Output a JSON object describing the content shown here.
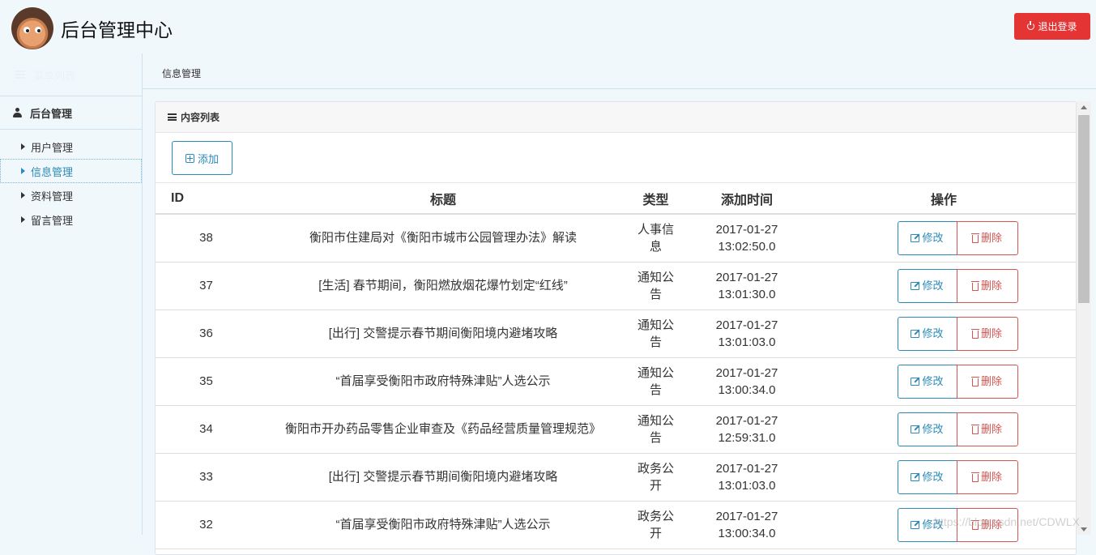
{
  "header": {
    "title": "后台管理中心",
    "logout_label": "退出登录",
    "logout_color": "#e53434"
  },
  "sidebar": {
    "menu_list_label": "菜单列表",
    "group_label": "后台管理",
    "items": [
      {
        "label": "用户管理",
        "active": false
      },
      {
        "label": "信息管理",
        "active": true
      },
      {
        "label": "资料管理",
        "active": false
      },
      {
        "label": "留言管理",
        "active": false
      }
    ]
  },
  "breadcrumb": "信息管理",
  "panel": {
    "title": "内容列表",
    "add_label": "添加",
    "columns": {
      "id": "ID",
      "title": "标题",
      "type": "类型",
      "time": "添加时间",
      "ops": "操作"
    },
    "edit_label": "修改",
    "delete_label": "删除",
    "rows": [
      {
        "id": "38",
        "title": "衡阳市住建局对《衡阳市城市公园管理办法》解读",
        "type": "人事信息",
        "date": "2017-01-27",
        "time": "13:02:50.0"
      },
      {
        "id": "37",
        "title": "[生活] 春节期间，衡阳燃放烟花爆竹划定“红线”",
        "type": "通知公告",
        "date": "2017-01-27",
        "time": "13:01:30.0"
      },
      {
        "id": "36",
        "title": "[出行] 交警提示春节期间衡阳境内避堵攻略",
        "type": "通知公告",
        "date": "2017-01-27",
        "time": "13:01:03.0"
      },
      {
        "id": "35",
        "title": "“首届享受衡阳市政府特殊津贴”人选公示",
        "type": "通知公告",
        "date": "2017-01-27",
        "time": "13:00:34.0"
      },
      {
        "id": "34",
        "title": "衡阳市开办药品零售企业审查及《药品经营质量管理规范》",
        "type": "通知公告",
        "date": "2017-01-27",
        "time": "12:59:31.0"
      },
      {
        "id": "33",
        "title": "[出行] 交警提示春节期间衡阳境内避堵攻略",
        "type": "政务公开",
        "date": "2017-01-27",
        "time": "13:01:03.0"
      },
      {
        "id": "32",
        "title": "“首届享受衡阳市政府特殊津贴”人选公示",
        "type": "政务公开",
        "date": "2017-01-27",
        "time": "13:00:34.0"
      }
    ]
  },
  "watermark": "https://blog.csdn.net/CDWLX"
}
